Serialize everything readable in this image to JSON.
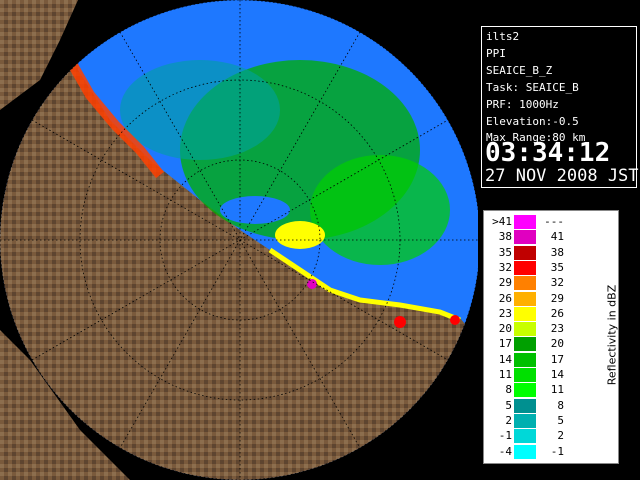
{
  "info": {
    "site": "ilts2",
    "product": "PPI",
    "variable": "SEAICE_B_Z",
    "task": "Task: SEAICE_B",
    "prf": "PRF: 1000Hz",
    "elevation": "Elevation:-0.5",
    "max_range": "Max Range:80 km",
    "time": "03:34:12",
    "date": "27 NOV 2008 JST"
  },
  "legend": {
    "units_label": "Reflectivity in dBZ",
    "rows": [
      {
        "left": ">41",
        "right": "---",
        "color": "#ff00ff"
      },
      {
        "left": "38",
        "right": "41",
        "color": "#e000c0"
      },
      {
        "left": "35",
        "right": "38",
        "color": "#c00000"
      },
      {
        "left": "32",
        "right": "35",
        "color": "#ff0000"
      },
      {
        "left": "29",
        "right": "32",
        "color": "#ff8000"
      },
      {
        "left": "26",
        "right": "29",
        "color": "#ffb000"
      },
      {
        "left": "23",
        "right": "26",
        "color": "#ffff00"
      },
      {
        "left": "20",
        "right": "23",
        "color": "#c8ff00"
      },
      {
        "left": "17",
        "right": "20",
        "color": "#00a000"
      },
      {
        "left": "14",
        "right": "17",
        "color": "#00c000"
      },
      {
        "left": "11",
        "right": "14",
        "color": "#00e000"
      },
      {
        "left": "8",
        "right": "11",
        "color": "#00ff00"
      },
      {
        "left": "5",
        "right": "8",
        "color": "#009090"
      },
      {
        "left": "2",
        "right": "5",
        "color": "#00b0b0"
      },
      {
        "left": "-1",
        "right": "2",
        "color": "#00d8d8"
      },
      {
        "left": "-4",
        "right": "-1",
        "color": "#00ffff"
      }
    ]
  },
  "colors": {
    "land": "#7a5a3c",
    "sea_blue": "#1e78ff",
    "range_ring": "#000000"
  }
}
